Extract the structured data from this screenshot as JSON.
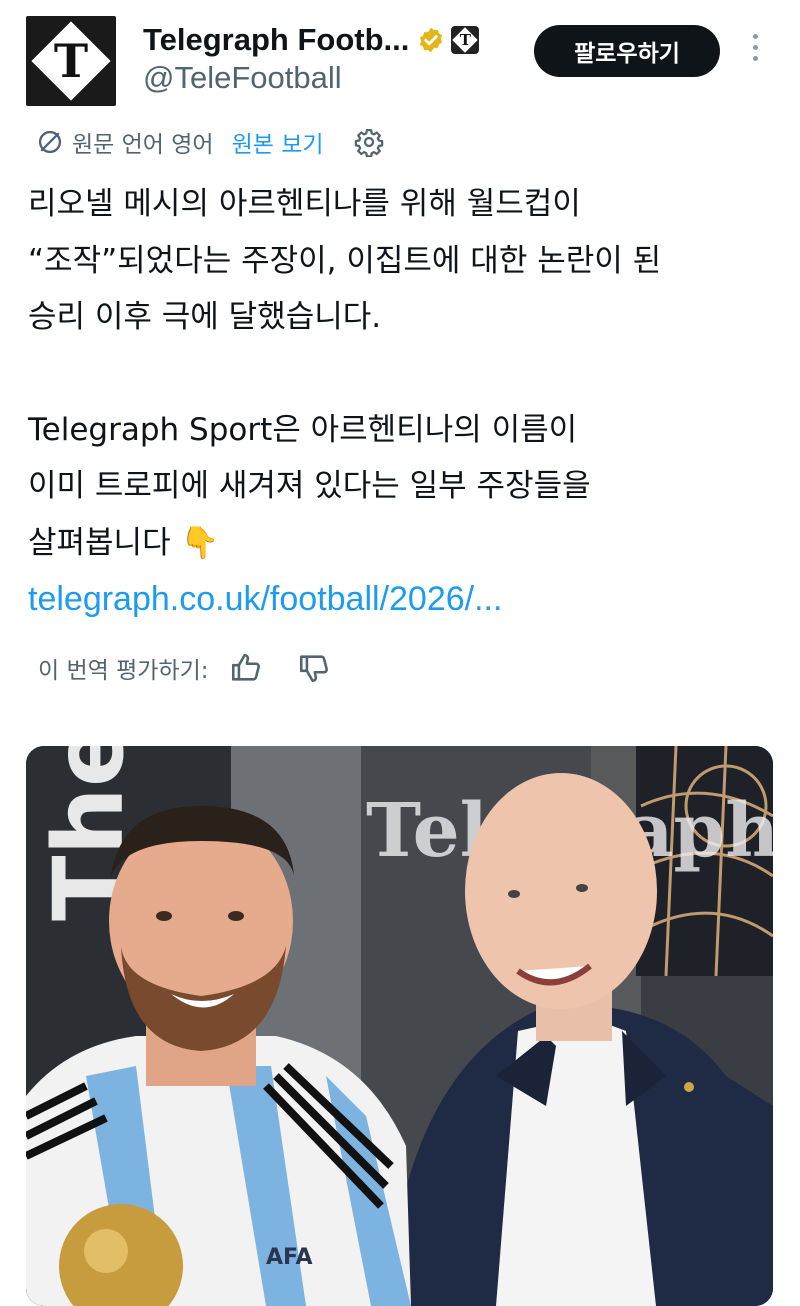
{
  "account": {
    "name": "Telegraph Footb...",
    "handle": "@TeleFootball",
    "avatar_letter": "T"
  },
  "follow_label": "팔로우하기",
  "translation": {
    "source_label": "원문 언어 영어",
    "view_original": "원본 보기"
  },
  "tweet": {
    "lines_1": [
      "리오넬 메시의 아르헨티나를 위해 월드컵이",
      "“조작”되었다는 주장이, 이집트에 대한 논란이 된",
      "승리 이후 극에 달했습니다."
    ],
    "lines_2": [
      "Telegraph Sport은 아르헨티나의 이름이",
      "이미 트로피에 새겨져 있다는 일부 주장들을",
      "살펴봅니다 👇"
    ],
    "link": "telegraph.co.uk/football/2026/..."
  },
  "rate_label": "이 번역 평가하기:",
  "media": {
    "watermark": "Telegraph",
    "banner_text": "The F",
    "badge_text": "AFA"
  },
  "colors": {
    "accent": "#1d9bf0",
    "text": "#0f1419",
    "secondary": "#536471",
    "verified": "#e2b719",
    "follow_bg": "#0f1419"
  },
  "icons": [
    "globe-slash-icon",
    "gear-icon",
    "verified-badge-icon",
    "affiliate-logo-icon",
    "more-icon",
    "thumbs-up-icon",
    "thumbs-down-icon",
    "pointing-down-emoji"
  ]
}
